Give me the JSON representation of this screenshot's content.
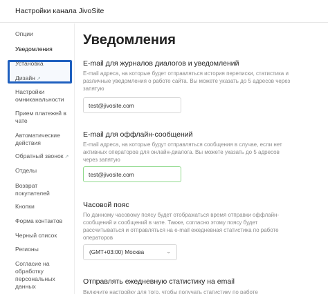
{
  "header": {
    "title": "Настройки канала JivoSite"
  },
  "sidebar": {
    "items": [
      {
        "label": "Опции"
      },
      {
        "label": "Уведомления"
      },
      {
        "label": "Установка"
      },
      {
        "label": "Дизайн"
      },
      {
        "label": "Настройки омниканальности"
      },
      {
        "label": "Прием платежей в чате"
      },
      {
        "label": "Автоматические действия"
      },
      {
        "label": "Обратный звонок"
      },
      {
        "label": "Отделы"
      },
      {
        "label": "Возврат покупателей"
      },
      {
        "label": "Кнопки"
      },
      {
        "label": "Форма контактов"
      },
      {
        "label": "Черный список"
      },
      {
        "label": "Регионы"
      },
      {
        "label": "Согласие на обработку персональных данных"
      }
    ],
    "external_icon": "external-link-icon",
    "active_item": "Уведомления"
  },
  "main": {
    "title": "Уведомления",
    "sections": [
      {
        "title": "E-mail для журналов диалогов и уведомлений",
        "description": "E-mail адреса, на которые будет отправляться история переписки, статистика и различные уведомления о работе сайта. Вы можете указать до 5 адресов через запятую",
        "value": "test@jivosite.com"
      },
      {
        "title": "E-mail для оффлайн-сообщений",
        "description": "E-mail адреса, на которые будут отправляться сообщения в случае, если нет активных операторов для онлайн-диалога. Вы можете указать до 5 адресов через запятую",
        "value": "test@jivosite.com"
      },
      {
        "title": "Часовой пояс",
        "description": "По данному часовому поясу будет отображаться время отправки оффлайн-сообщений и сообщений в чате. Также, согласно этому поясу будет рассчитываться и отправляться на e-mail ежедневная статистика по работе операторов",
        "value": "(GMT+03:00) Москва"
      },
      {
        "title": "Отправлять ежедневную статистику на email",
        "description": "Включите настройку для того, чтобы получать статистику по работе"
      }
    ]
  },
  "colors": {
    "highlight": "#1e5fbf",
    "focus_border": "#8ed98a"
  }
}
